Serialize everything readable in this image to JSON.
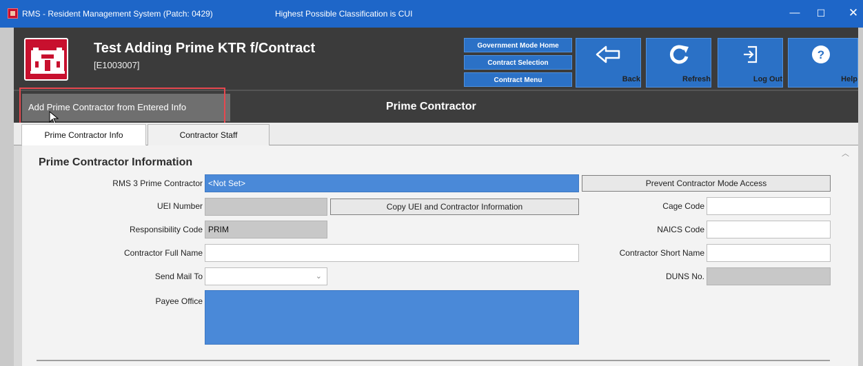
{
  "window": {
    "title": "RMS - Resident Management System (Patch: 0429)",
    "classification": "Highest Possible Classification is CUI",
    "minimize_glyph": "—",
    "maximize_glyph": "☐",
    "close_glyph": "✕"
  },
  "header": {
    "title": "Test Adding Prime KTR f/Contract",
    "subtitle": "[E1003007]"
  },
  "nav_links": {
    "gov_home": "Government Mode Home",
    "contract_selection": "Contract Selection",
    "contract_menu": "Contract Menu"
  },
  "toolbar": {
    "back": "Back",
    "refresh": "Refresh",
    "logout": "Log Out",
    "help": "Help"
  },
  "subheader": {
    "add_button": "Add Prime Contractor from Entered Info",
    "title": "Prime Contractor"
  },
  "tabs": [
    {
      "label": "Prime Contractor Info"
    },
    {
      "label": "Contractor Staff"
    }
  ],
  "section": {
    "title": "Prime Contractor Information"
  },
  "form": {
    "rms3_prime_contractor": {
      "label": "RMS 3 Prime Contractor",
      "value": "<Not Set>"
    },
    "prevent_access_button": "Prevent Contractor Mode Access",
    "uei": {
      "label": "UEI Number",
      "value": ""
    },
    "copy_uei_button": "Copy UEI and Contractor Information",
    "cage_code": {
      "label": "Cage Code",
      "value": ""
    },
    "responsibility_code": {
      "label": "Responsibility Code",
      "value": "PRIM"
    },
    "naics_code": {
      "label": "NAICS Code",
      "value": ""
    },
    "contractor_full_name": {
      "label": "Contractor Full Name",
      "value": ""
    },
    "contractor_short_name": {
      "label": "Contractor Short Name",
      "value": ""
    },
    "send_mail_to": {
      "label": "Send Mail To",
      "value": ""
    },
    "duns": {
      "label": "DUNS No.",
      "value": ""
    },
    "payee_office": {
      "label": "Payee Office",
      "value": ""
    }
  },
  "icons": {
    "app": "rms-castle-icon",
    "logo": "usace-castle-icon",
    "back": "back-arrow-icon",
    "refresh": "refresh-icon",
    "logout": "logout-icon",
    "help": "help-icon",
    "scroll": "scroll-up-icon",
    "cursor": "mouse-cursor-icon"
  }
}
